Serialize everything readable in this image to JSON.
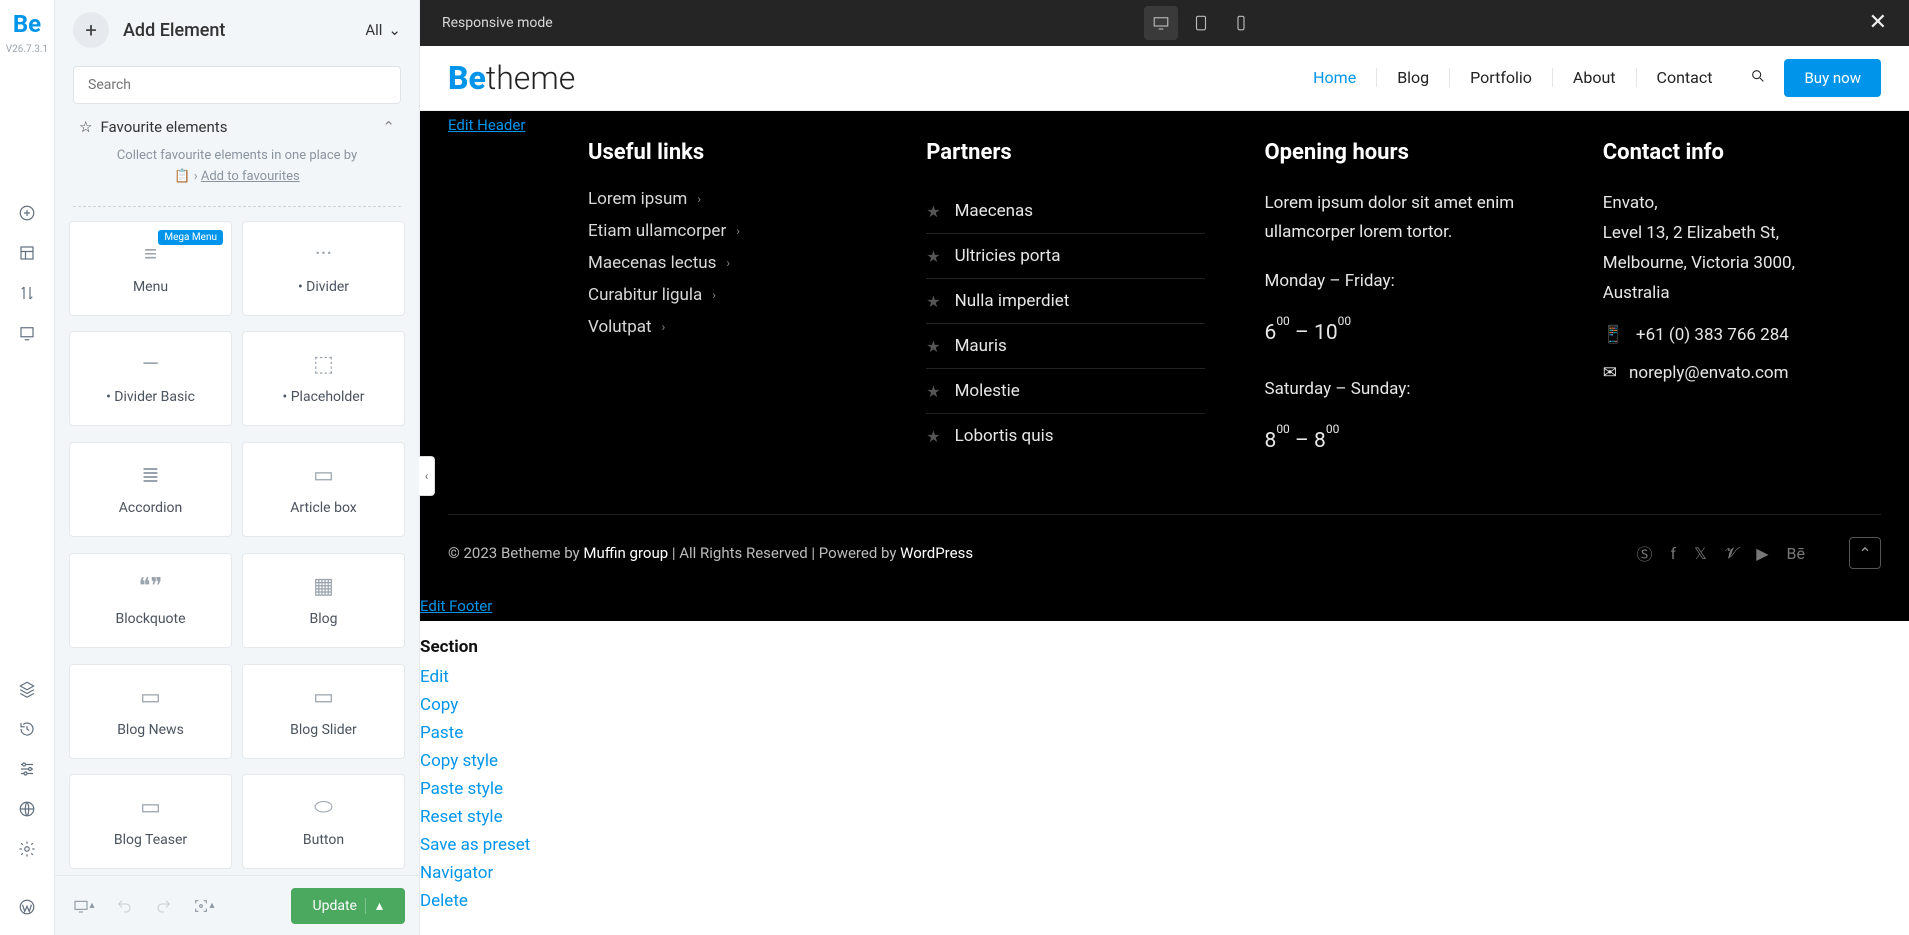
{
  "rail": {
    "logo": "Be",
    "version": "V26.7.3.1"
  },
  "sidebar": {
    "title": "Add Element",
    "filter": "All",
    "search_ph": "Search",
    "fav_title": "Favourite elements",
    "fav_note": "Collect favourite elements in one place by",
    "fav_link": "Add to favourites",
    "elements": [
      {
        "label": "Menu",
        "badge": "Mega Menu"
      },
      {
        "label": "• Divider"
      },
      {
        "label": "• Divider Basic"
      },
      {
        "label": "• Placeholder"
      },
      {
        "label": "Accordion"
      },
      {
        "label": "Article box"
      },
      {
        "label": "Blockquote"
      },
      {
        "label": "Blog"
      },
      {
        "label": "Blog News"
      },
      {
        "label": "Blog Slider"
      },
      {
        "label": "Blog Teaser"
      },
      {
        "label": "Button"
      }
    ],
    "update": "Update"
  },
  "topbar": {
    "mode": "Responsive mode"
  },
  "site": {
    "brand1": "Be",
    "brand2": "theme",
    "nav": [
      "Home",
      "Blog",
      "Portfolio",
      "About",
      "Contact"
    ],
    "buy": "Buy now"
  },
  "footer": {
    "edit_header": "Edit Header",
    "edit_footer": "Edit Footer",
    "useful": {
      "h": "Useful links",
      "items": [
        "Lorem ipsum",
        "Etiam ullamcorper",
        "Maecenas lectus",
        "Curabitur ligula",
        "Volutpat"
      ]
    },
    "partners": {
      "h": "Partners",
      "items": [
        "Maecenas",
        "Ultricies porta",
        "Nulla imperdiet",
        "Mauris",
        "Molestie",
        "Lobortis quis"
      ]
    },
    "hours": {
      "h": "Opening hours",
      "p": "Lorem ipsum dolor sit amet enim ullamcorper lorem tortor.",
      "l1": "Monday – Friday:",
      "t1a": "6",
      "t1b": "00",
      "dash": " – ",
      "t1c": "10",
      "t1d": "00",
      "l2": "Saturday – Sunday:",
      "t2a": "8",
      "t2b": "00",
      "t2c": "8",
      "t2d": "00"
    },
    "contact": {
      "h": "Contact info",
      "lines": [
        "Envato,",
        "Level 13, 2 Elizabeth St,",
        "Melbourne, Victoria 3000,",
        "Australia"
      ],
      "phone": "+61 (0) 383 766 284",
      "email": "noreply@envato.com"
    },
    "copy": {
      "pre": "© 2023 Betheme by ",
      "muffin": "Muffin group",
      "mid": " | All Rights Reserved | Powered by ",
      "wp": "WordPress"
    }
  },
  "ctx": {
    "title": "Section",
    "items": [
      "Edit",
      "Copy",
      "Paste",
      "Copy style",
      "Paste style",
      "Reset style",
      "Save as preset",
      "Navigator",
      "Delete"
    ]
  }
}
